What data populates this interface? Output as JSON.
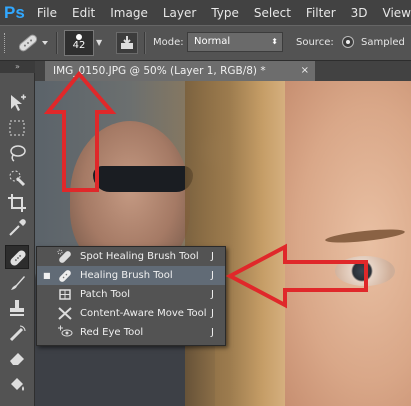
{
  "app": {
    "logo": "Ps"
  },
  "menu": [
    "File",
    "Edit",
    "Image",
    "Layer",
    "Type",
    "Select",
    "Filter",
    "3D",
    "View"
  ],
  "options_bar": {
    "brush_size": "42",
    "mode_label": "Mode:",
    "mode_value": "Normal",
    "source_label": "Source:",
    "source_value": "Sampled"
  },
  "document_tab": {
    "title": "IMG_0150.JPG @ 50% (Layer 1, RGB/8) *",
    "close": "×"
  },
  "toolbar": {
    "collapse": "»"
  },
  "flyout": {
    "items": [
      {
        "label": "Spot Healing Brush Tool",
        "shortcut": "J",
        "selected": false,
        "icon": "spot-healing-brush-icon"
      },
      {
        "label": "Healing Brush Tool",
        "shortcut": "J",
        "selected": true,
        "icon": "healing-brush-icon"
      },
      {
        "label": "Patch Tool",
        "shortcut": "J",
        "selected": false,
        "icon": "patch-icon"
      },
      {
        "label": "Content-Aware Move Tool",
        "shortcut": "J",
        "selected": false,
        "icon": "content-aware-move-icon"
      },
      {
        "label": "Red Eye Tool",
        "shortcut": "J",
        "selected": false,
        "icon": "red-eye-icon"
      }
    ]
  },
  "colors": {
    "annotation_arrow": "#e0282a",
    "ui_dark": "#535353",
    "selection": "#616b76"
  }
}
